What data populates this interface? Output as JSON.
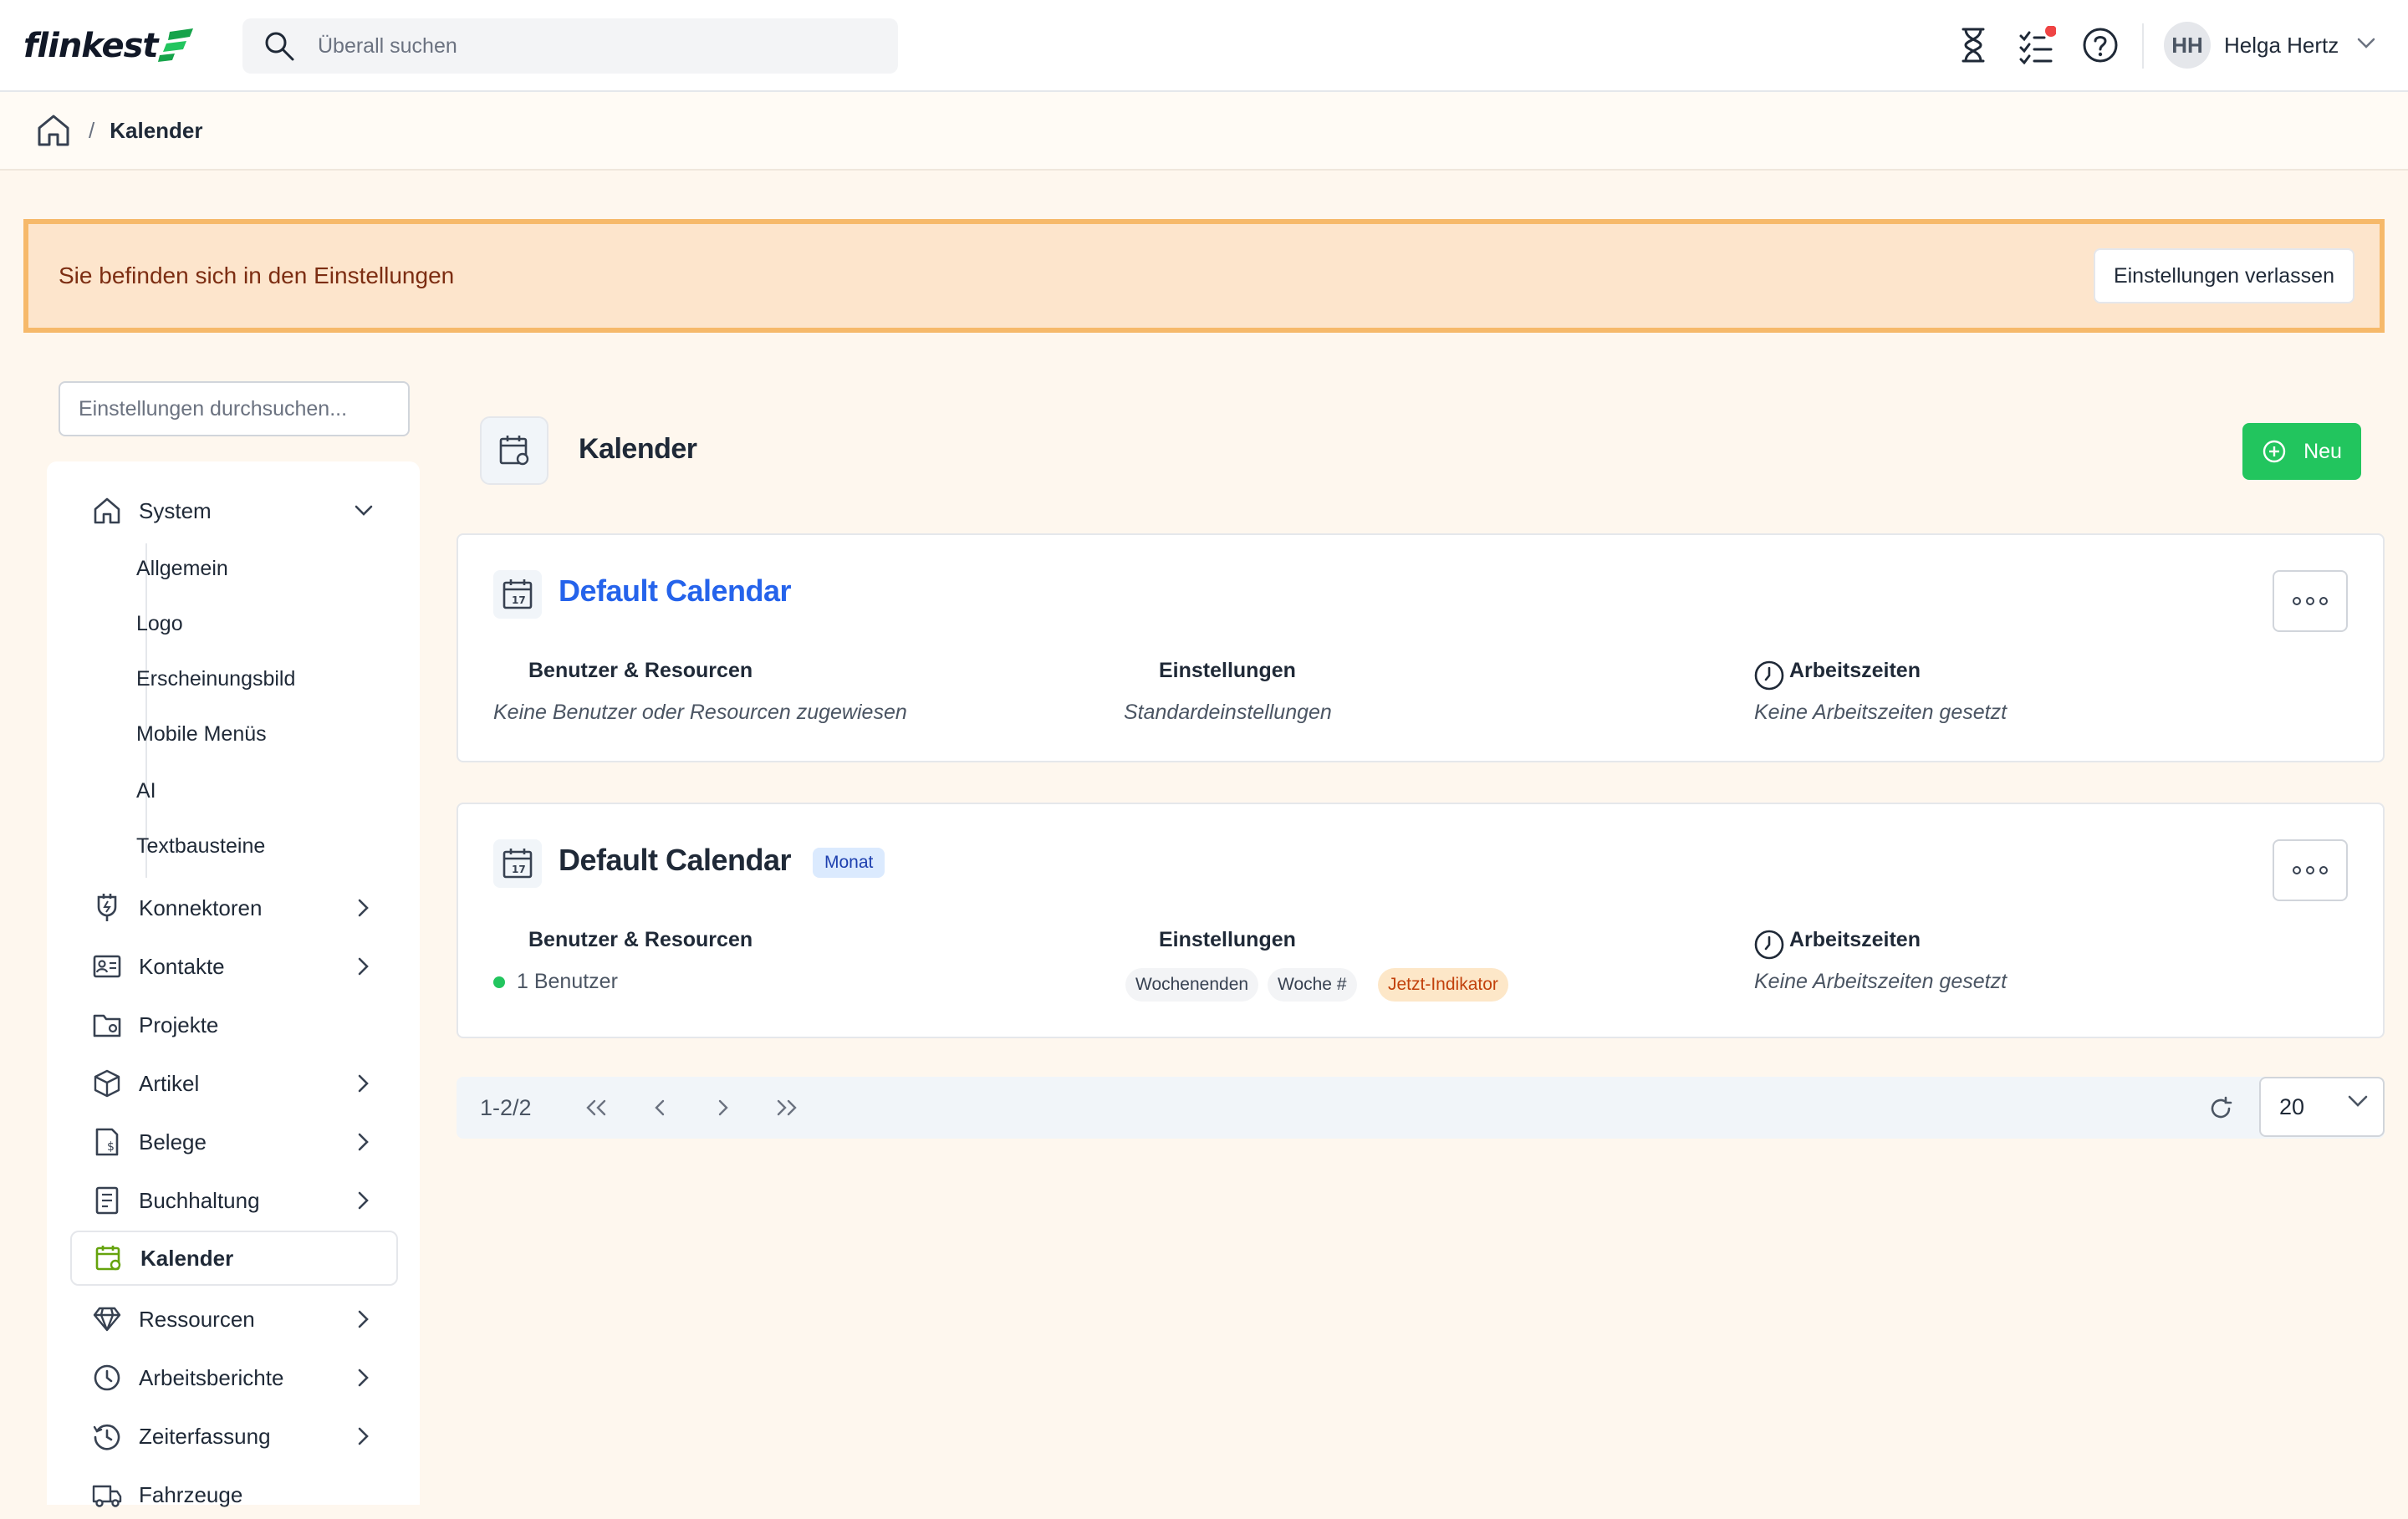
{
  "header": {
    "logo_text": "flinkest",
    "search_placeholder": "Überall suchen",
    "icons": [
      "hourglass-icon",
      "tasks-icon",
      "help-icon"
    ],
    "user": {
      "initials": "HH",
      "name": "Helga Hertz"
    }
  },
  "breadcrumb": {
    "separator": "/",
    "current": "Kalender"
  },
  "banner": {
    "text": "Sie befinden sich in den Einstellungen",
    "button": "Einstellungen verlassen"
  },
  "sidebar": {
    "search_placeholder": "Einstellungen durchsuchen...",
    "system": {
      "label": "System",
      "children": [
        "Allgemein",
        "Logo",
        "Erscheinungsbild",
        "Mobile Menüs",
        "AI",
        "Textbausteine"
      ]
    },
    "items": [
      {
        "label": "Konnektoren",
        "icon": "connector-icon",
        "expandable": true
      },
      {
        "label": "Kontakte",
        "icon": "contact-card-icon",
        "expandable": true
      },
      {
        "label": "Projekte",
        "icon": "project-folder-icon",
        "expandable": false
      },
      {
        "label": "Artikel",
        "icon": "box-icon",
        "expandable": true
      },
      {
        "label": "Belege",
        "icon": "receipt-icon",
        "expandable": true
      },
      {
        "label": "Buchhaltung",
        "icon": "ledger-icon",
        "expandable": true
      },
      {
        "label": "Kalender",
        "icon": "calendar-settings-icon",
        "expandable": false,
        "active": true
      },
      {
        "label": "Ressourcen",
        "icon": "diamond-icon",
        "expandable": true
      },
      {
        "label": "Arbeitsberichte",
        "icon": "clock-icon",
        "expandable": true
      },
      {
        "label": "Zeiterfassung",
        "icon": "history-icon",
        "expandable": true
      },
      {
        "label": "Fahrzeuge",
        "icon": "truck-icon",
        "expandable": false
      }
    ]
  },
  "main": {
    "title": "Kalender",
    "new_button": "Neu",
    "colors": {
      "accent_green": "#22c55e",
      "link_blue": "#2563eb",
      "banner_border": "#f6b96a"
    },
    "calendars": [
      {
        "name": "Default Calendar",
        "badge": "",
        "col1_label": "Benutzer & Resourcen",
        "col1_value": "Keine Benutzer oder Resourcen zugewiesen",
        "col2_label": "Einstellungen",
        "col2_value": "Standardeinstellungen",
        "col3_label": "Arbeitszeiten",
        "col3_value": "Keine Arbeitszeiten gesetzt"
      },
      {
        "name": "Default Calendar",
        "badge": "Monat",
        "col1_label": "Benutzer & Resourcen",
        "col1_value": "1 Benutzer",
        "col2_label": "Einstellungen",
        "tags": [
          "Wochenenden",
          "Woche #",
          "Jetzt-Indikator"
        ],
        "col3_label": "Arbeitszeiten",
        "col3_value": "Keine Arbeitszeiten gesetzt"
      }
    ],
    "pagination": {
      "range": "1-2/2",
      "page_size": "20"
    }
  }
}
